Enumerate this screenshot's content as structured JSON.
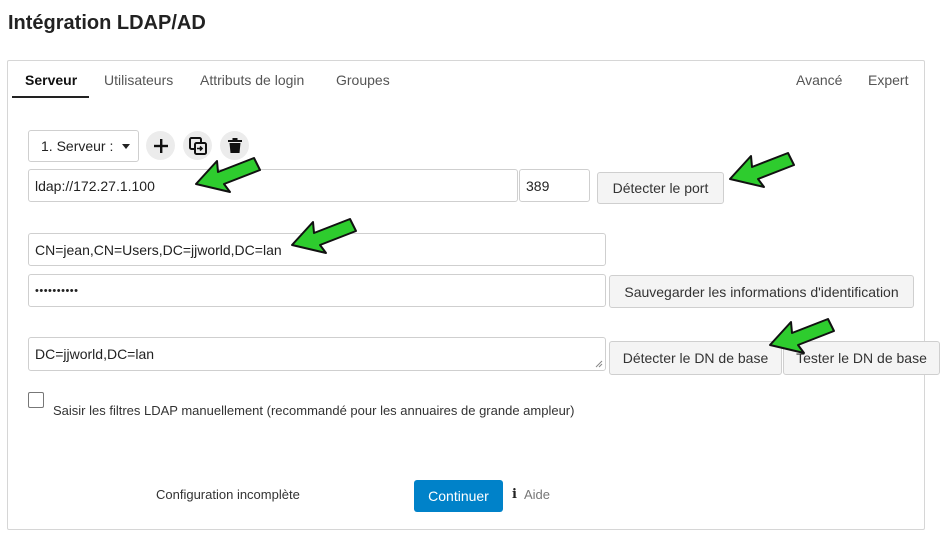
{
  "page": {
    "title": "Intégration LDAP/AD"
  },
  "tabs": {
    "server": "Serveur",
    "users": "Utilisateurs",
    "login_attributes": "Attributs de login",
    "groups": "Groupes",
    "advanced": "Avancé",
    "expert": "Expert"
  },
  "server": {
    "selector_value": "1. Serveur :",
    "host_value": "ldap://172.27.1.100",
    "port_value": "389",
    "detect_port_label": "Détecter le port",
    "user_dn_value": "CN=jean,CN=Users,DC=jjworld,DC=lan",
    "password_value": "••••••••••",
    "save_credentials_label": "Sauvegarder les informations d'identification",
    "base_dn_value": "DC=jjworld,DC=lan",
    "detect_base_dn_label": "Détecter le DN de base",
    "test_base_dn_label": "Tester le DN de base",
    "manual_filter_label": "Saisir les filtres LDAP manuellement (recommandé pour les annuaires de grande ampleur)"
  },
  "footer": {
    "status_text": "Configuration incomplète",
    "continue_label": "Continuer",
    "help_label": "Aide"
  },
  "icons": {
    "add": "plus-icon",
    "copy": "copy-icon",
    "delete": "trash-icon",
    "dropdown": "caret-down-icon",
    "info": "info-icon",
    "annotation": "green-arrow"
  },
  "colors": {
    "primary": "#0082c9",
    "annotation_arrow": "#2ecc2e"
  }
}
